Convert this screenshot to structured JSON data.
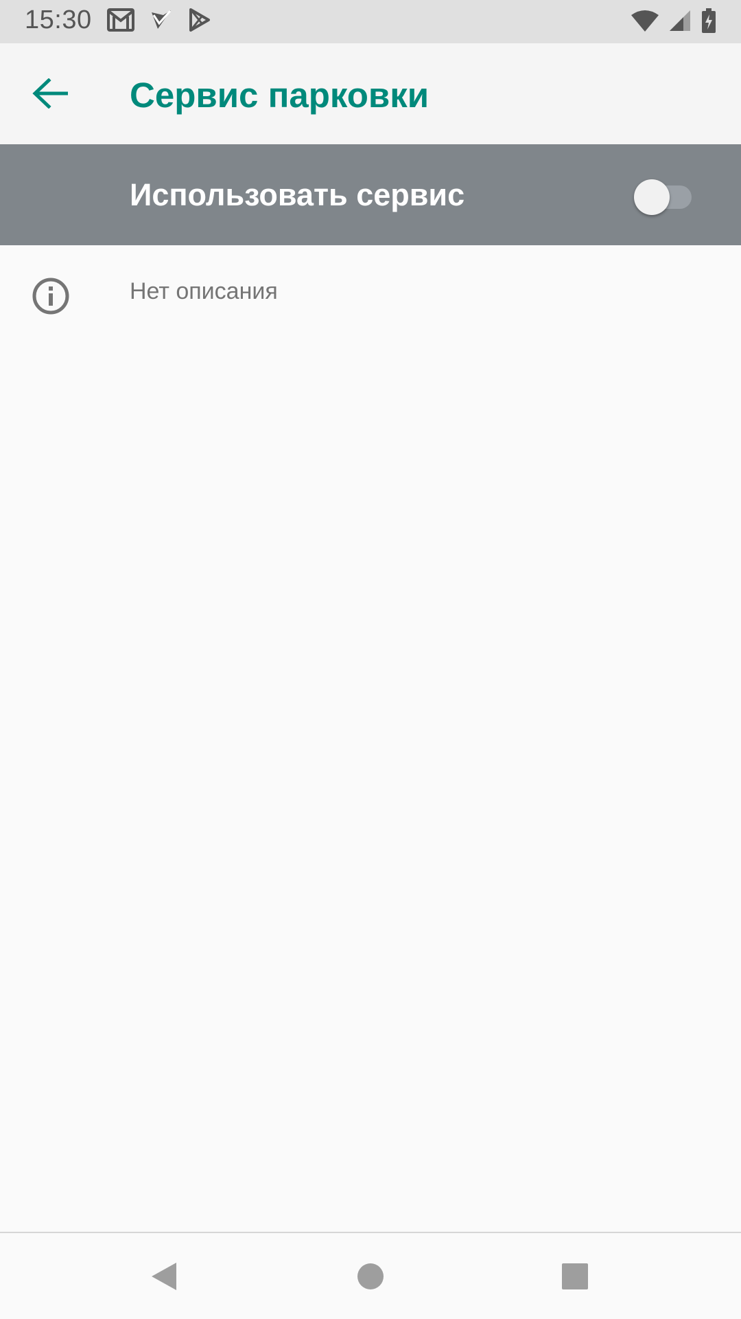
{
  "status_bar": {
    "time": "15:30",
    "icons": [
      "gmail-icon",
      "tasks-icon",
      "play-store-icon",
      "wifi-icon",
      "signal-icon",
      "battery-charging-icon"
    ]
  },
  "app_bar": {
    "title": "Сервис парковки",
    "back_icon": "back-arrow-icon"
  },
  "master_switch": {
    "label": "Использовать сервис",
    "state": "off"
  },
  "info": {
    "text": "Нет описания",
    "icon": "info-icon"
  },
  "nav_bar": {
    "buttons": [
      "back-nav-icon",
      "home-nav-icon",
      "recents-nav-icon"
    ]
  },
  "colors": {
    "accent": "#00897b",
    "master_switch_bg": "#80868b",
    "status_bar_bg": "#e0e0e0",
    "app_bar_bg": "#f5f5f5",
    "page_bg": "#fafafa",
    "secondary_text": "#757575"
  }
}
